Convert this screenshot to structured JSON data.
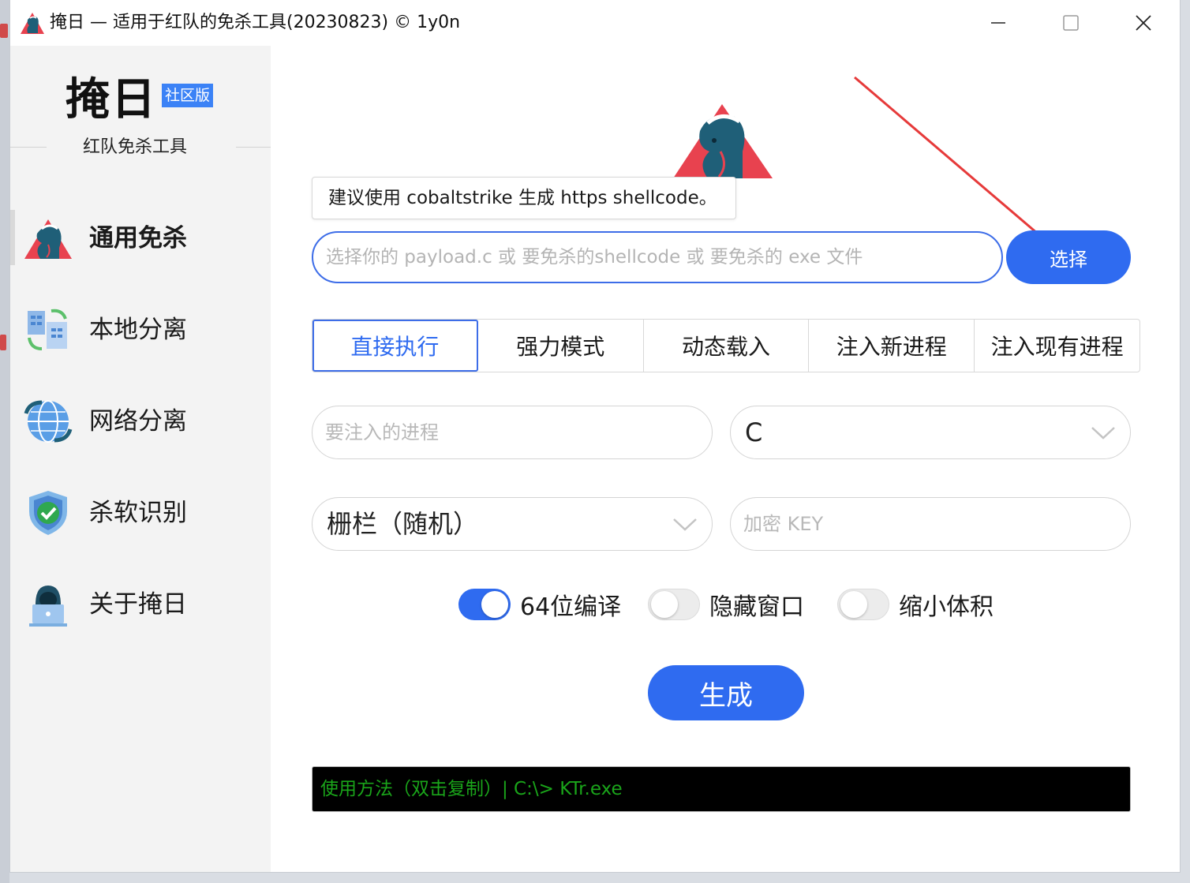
{
  "window": {
    "title": "掩日 — 适用于红队的免杀工具(20230823) © 1y0n"
  },
  "sidebar": {
    "brand_title": "掩日",
    "brand_badge": "社区版",
    "brand_subtitle": "红队免杀工具",
    "items": [
      {
        "label": "通用免杀",
        "icon": "horse-logo-icon",
        "active": true
      },
      {
        "label": "本地分离",
        "icon": "local-separation-icon",
        "active": false
      },
      {
        "label": "网络分离",
        "icon": "globe-icon",
        "active": false
      },
      {
        "label": "杀软识别",
        "icon": "shield-check-icon",
        "active": false
      },
      {
        "label": "关于掩日",
        "icon": "hacker-laptop-icon",
        "active": false
      }
    ]
  },
  "main": {
    "tip_text": "建议使用 cobaltstrike 生成 https shellcode。",
    "payload_placeholder": "选择你的 payload.c 或 要免杀的shellcode 或 要免杀的 exe 文件",
    "select_button": "选择",
    "tabs": [
      {
        "label": "直接执行",
        "active": true
      },
      {
        "label": "强力模式",
        "active": false
      },
      {
        "label": "动态载入",
        "active": false
      },
      {
        "label": "注入新进程",
        "active": false
      },
      {
        "label": "注入现有进程",
        "active": false
      }
    ],
    "process_placeholder": "要注入的进程",
    "language_select_value": "C",
    "encryption_select_value": "栅栏（随机）",
    "key_placeholder": "加密 KEY",
    "switches": [
      {
        "label": "64位编译",
        "on": true
      },
      {
        "label": "隐藏窗口",
        "on": false
      },
      {
        "label": "缩小体积",
        "on": false
      }
    ],
    "generate_button": "生成",
    "console_text": "使用方法（双击复制）| C:\\> KTr.exe"
  },
  "colors": {
    "accent": "#2f6bf0",
    "sidebar_bg": "#f3f3f3",
    "console_text": "#1aa51a",
    "logo_red": "#e8424f",
    "logo_teal": "#1f5f78"
  }
}
